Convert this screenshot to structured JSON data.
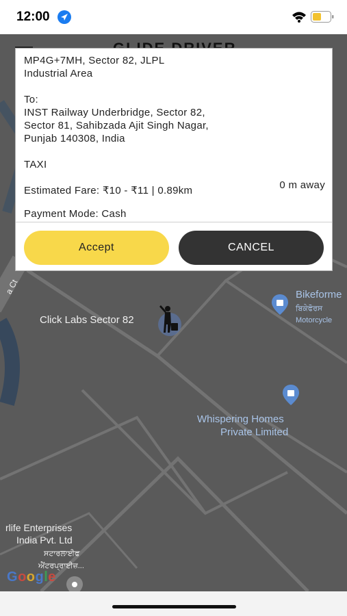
{
  "status_bar": {
    "time": "12:00",
    "location_icon": "location-arrow-icon",
    "wifi_icon": "wifi-icon",
    "battery_icon": "battery-icon",
    "battery_color": "#f2c230"
  },
  "app": {
    "title": "GLIDE DRIVER",
    "accent": "#f8d84a"
  },
  "map": {
    "labels": {
      "click_labs": "Click Labs Sector 82",
      "bikeformers": "Bikeforme",
      "bikeformers_punjabi": "ਬਿਕੇਫੋਰਸ",
      "bikeformers_sub": "Motorcycle",
      "whispering_1": "Whispering Homes",
      "whispering_2": "Private Limited",
      "enterprises_1": "rlife Enterprises",
      "enterprises_2": "India Pvt. Ltd",
      "enterprises_punjabi_1": "ਸਟਾਰਲਾਈਫ",
      "enterprises_punjabi_2": "ਐਂਟਰਪ੍ਰਾਈਜ਼...",
      "road_left": "a Ct"
    },
    "google_logo": [
      "G",
      "o",
      "o",
      "g",
      "l",
      "e"
    ]
  },
  "ride_request": {
    "pickup": "MP4G+7MH, Sector 82, JLPL\nIndustrial Area",
    "to_label": "To:",
    "dropoff": "INST Railway Underbridge, Sector 82,\nSector 81, Sahibzada Ajit Singh Nagar,\nPunjab 140308, India",
    "distance": "0 m away",
    "car_type": "TAXI",
    "fare": "Estimated Fare: ₹10 - ₹11 | 0.89km",
    "payment": "Payment Mode: Cash",
    "accept_label": "Accept",
    "cancel_label": "CANCEL"
  }
}
